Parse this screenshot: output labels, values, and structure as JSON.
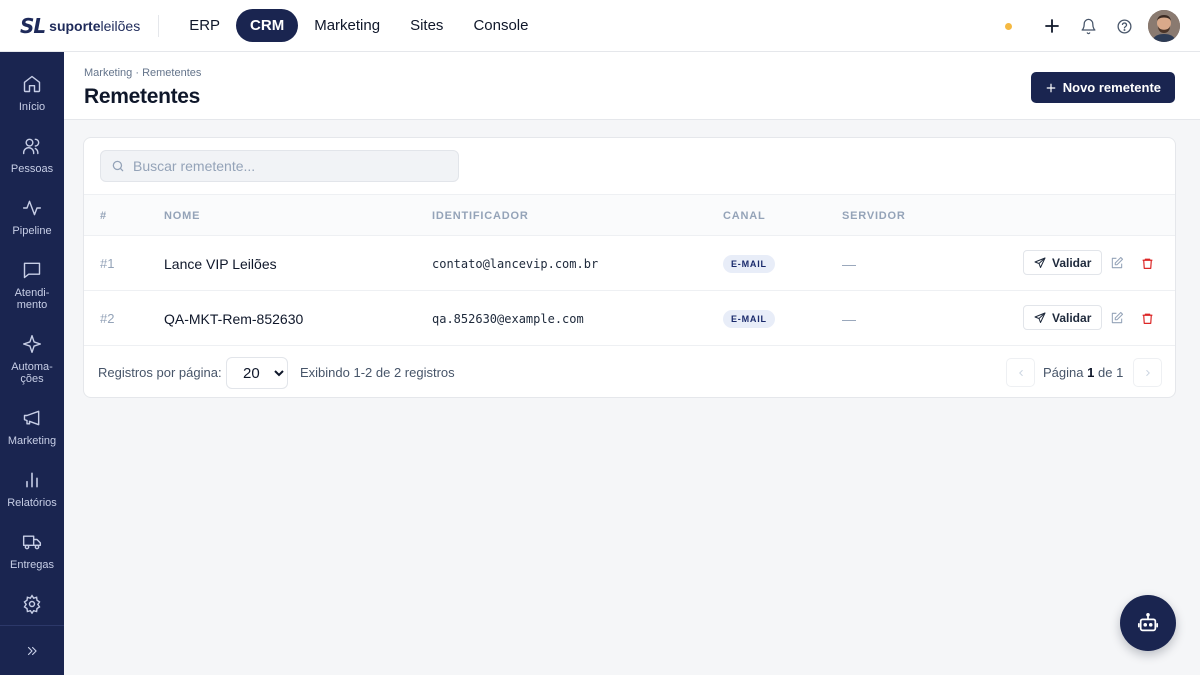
{
  "brand": {
    "mark": "SL",
    "name_bold": "suporte",
    "name_light": "leilões"
  },
  "nav": [
    {
      "label": "ERP",
      "active": false
    },
    {
      "label": "CRM",
      "active": true
    },
    {
      "label": "Marketing",
      "active": false
    },
    {
      "label": "Sites",
      "active": false
    },
    {
      "label": "Console",
      "active": false
    }
  ],
  "sidebar": {
    "items": [
      {
        "label": "Início",
        "icon": "home-icon"
      },
      {
        "label": "Pessoas",
        "icon": "users-icon"
      },
      {
        "label": "Pipeline",
        "icon": "activity-icon"
      },
      {
        "label": "Atendi-\nmento",
        "icon": "chat-icon"
      },
      {
        "label": "Automa-\nções",
        "icon": "sparkle-icon"
      },
      {
        "label": "Marketing",
        "icon": "megaphone-icon"
      },
      {
        "label": "Relatórios",
        "icon": "bar-chart-icon"
      },
      {
        "label": "Entregas",
        "icon": "truck-icon"
      },
      {
        "label": "",
        "icon": "gear-icon"
      }
    ],
    "expand_icon": "chevrons-right-icon"
  },
  "header": {
    "breadcrumb": "Marketing · Remetentes",
    "title": "Remetentes",
    "new_button": "Novo remetente"
  },
  "search": {
    "placeholder": "Buscar remetente..."
  },
  "table": {
    "columns": [
      "#",
      "NOME",
      "IDENTIFICADOR",
      "CANAL",
      "SERVIDOR"
    ],
    "rows": [
      {
        "num": "#1",
        "nome": "Lance VIP Leilões",
        "identificador": "contato@lancevip.com.br",
        "canal": "E-MAIL",
        "servidor": "—",
        "validar": "Validar"
      },
      {
        "num": "#2",
        "nome": "QA-MKT-Rem-852630",
        "identificador": "qa.852630@example.com",
        "canal": "E-MAIL",
        "servidor": "—",
        "validar": "Validar"
      }
    ]
  },
  "footer": {
    "per_page_label": "Registros por página:",
    "per_page_value": "20",
    "info": "Exibindo 1-2 de 2 registros",
    "page_prefix": "Página",
    "page_current": "1",
    "page_sep": "de",
    "page_total": "1"
  },
  "colors": {
    "primary": "#1a2550",
    "status_dot": "#f5b942",
    "danger": "#dc2626"
  }
}
